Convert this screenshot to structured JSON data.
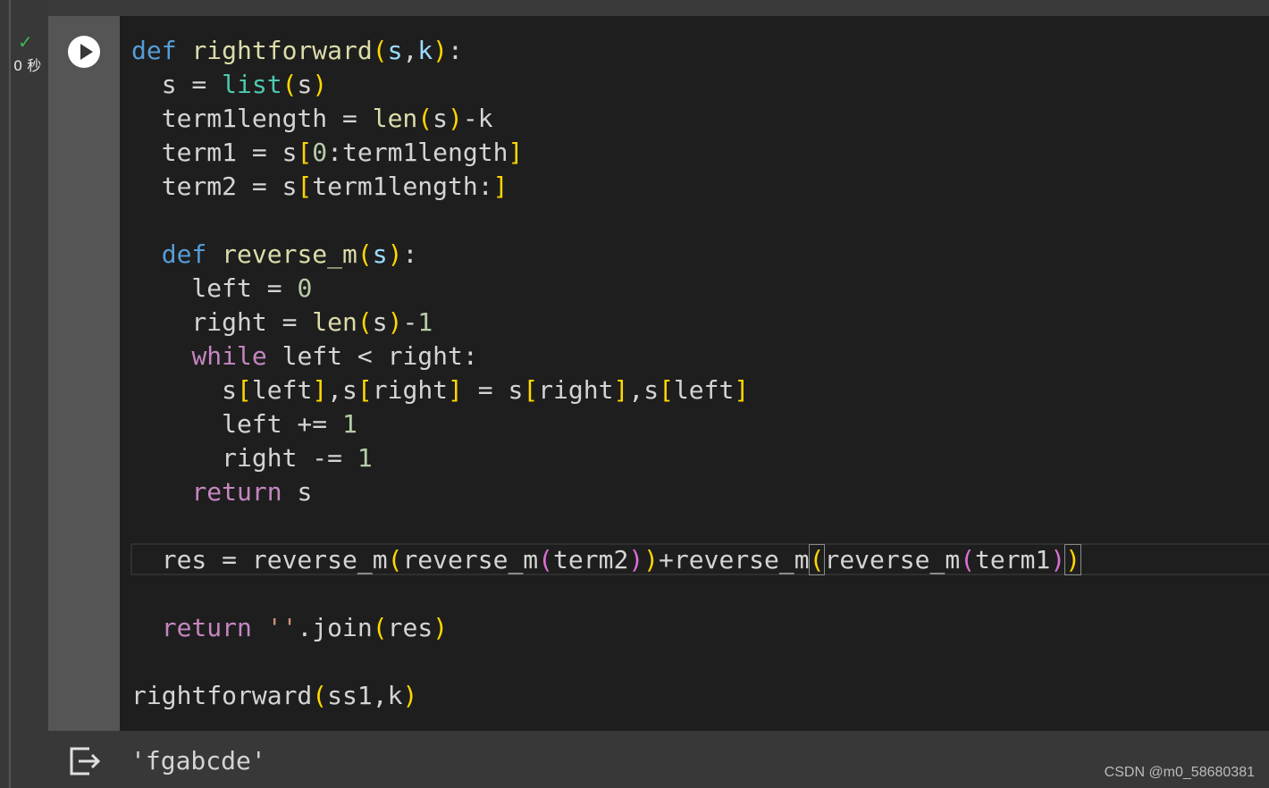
{
  "cell": {
    "status_icon": "check-icon",
    "exec_time": "0 秒",
    "run_button_icon": "play-icon",
    "code_lines": [
      [
        {
          "t": "def",
          "c": "kw"
        },
        {
          "t": " "
        },
        {
          "t": "rightforward",
          "c": "fn"
        },
        {
          "t": "(",
          "c": "b1"
        },
        {
          "t": "s",
          "c": "pm"
        },
        {
          "t": ","
        },
        {
          "t": "k",
          "c": "pm"
        },
        {
          "t": ")",
          "c": "b1"
        },
        {
          "t": ":"
        }
      ],
      [
        {
          "t": "  s = "
        },
        {
          "t": "list",
          "c": "bi"
        },
        {
          "t": "(",
          "c": "b1"
        },
        {
          "t": "s"
        },
        {
          "t": ")",
          "c": "b1"
        }
      ],
      [
        {
          "t": "  term1length = "
        },
        {
          "t": "len",
          "c": "fn"
        },
        {
          "t": "(",
          "c": "b1"
        },
        {
          "t": "s"
        },
        {
          "t": ")",
          "c": "b1"
        },
        {
          "t": "-k"
        }
      ],
      [
        {
          "t": "  term1 = s"
        },
        {
          "t": "[",
          "c": "b1"
        },
        {
          "t": "0",
          "c": "num"
        },
        {
          "t": ":term1length"
        },
        {
          "t": "]",
          "c": "b1"
        }
      ],
      [
        {
          "t": "  term2 = s"
        },
        {
          "t": "[",
          "c": "b1"
        },
        {
          "t": "term1length:"
        },
        {
          "t": "]",
          "c": "b1"
        }
      ],
      [],
      [
        {
          "t": "  "
        },
        {
          "t": "def",
          "c": "kw"
        },
        {
          "t": " "
        },
        {
          "t": "reverse_m",
          "c": "fn"
        },
        {
          "t": "(",
          "c": "b1"
        },
        {
          "t": "s",
          "c": "pm"
        },
        {
          "t": ")",
          "c": "b1"
        },
        {
          "t": ":"
        }
      ],
      [
        {
          "t": "    left = "
        },
        {
          "t": "0",
          "c": "num"
        }
      ],
      [
        {
          "t": "    right = "
        },
        {
          "t": "len",
          "c": "fn"
        },
        {
          "t": "(",
          "c": "b1"
        },
        {
          "t": "s"
        },
        {
          "t": ")",
          "c": "b1"
        },
        {
          "t": "-"
        },
        {
          "t": "1",
          "c": "num"
        }
      ],
      [
        {
          "t": "    "
        },
        {
          "t": "while",
          "c": "ctl"
        },
        {
          "t": " left < right:"
        }
      ],
      [
        {
          "t": "      s"
        },
        {
          "t": "[",
          "c": "b1"
        },
        {
          "t": "left"
        },
        {
          "t": "]",
          "c": "b1"
        },
        {
          "t": ",s"
        },
        {
          "t": "[",
          "c": "b1"
        },
        {
          "t": "right"
        },
        {
          "t": "]",
          "c": "b1"
        },
        {
          "t": " = s"
        },
        {
          "t": "[",
          "c": "b1"
        },
        {
          "t": "right"
        },
        {
          "t": "]",
          "c": "b1"
        },
        {
          "t": ",s"
        },
        {
          "t": "[",
          "c": "b1"
        },
        {
          "t": "left"
        },
        {
          "t": "]",
          "c": "b1"
        }
      ],
      [
        {
          "t": "      left += "
        },
        {
          "t": "1",
          "c": "num"
        }
      ],
      [
        {
          "t": "      right -= "
        },
        {
          "t": "1",
          "c": "num"
        }
      ],
      [
        {
          "t": "    "
        },
        {
          "t": "return",
          "c": "ctl"
        },
        {
          "t": " s"
        }
      ],
      [],
      [
        {
          "t": "  res = reverse_m"
        },
        {
          "t": "(",
          "c": "b1"
        },
        {
          "t": "reverse_m"
        },
        {
          "t": "(",
          "c": "b2"
        },
        {
          "t": "term2"
        },
        {
          "t": ")",
          "c": "b2"
        },
        {
          "t": ")",
          "c": "b1"
        },
        {
          "t": "+reverse_m"
        },
        {
          "t": "(",
          "c": "bm"
        },
        {
          "t": "reverse_m"
        },
        {
          "t": "(",
          "c": "b2"
        },
        {
          "t": "term1"
        },
        {
          "t": ")",
          "c": "b2"
        },
        {
          "t": ")",
          "c": "bm"
        }
      ],
      [],
      [
        {
          "t": "  "
        },
        {
          "t": "return",
          "c": "ctl"
        },
        {
          "t": " "
        },
        {
          "t": "''",
          "c": "str"
        },
        {
          "t": ".join"
        },
        {
          "t": "(",
          "c": "b1"
        },
        {
          "t": "res"
        },
        {
          "t": ")",
          "c": "b1"
        }
      ],
      [],
      [
        {
          "t": "rightforward"
        },
        {
          "t": "(",
          "c": "b1"
        },
        {
          "t": "ss1,k"
        },
        {
          "t": ")",
          "c": "b1"
        }
      ]
    ]
  },
  "output": {
    "icon": "output-exit-icon",
    "text": "'fgabcde'"
  },
  "watermark": "CSDN @m0_58680381"
}
